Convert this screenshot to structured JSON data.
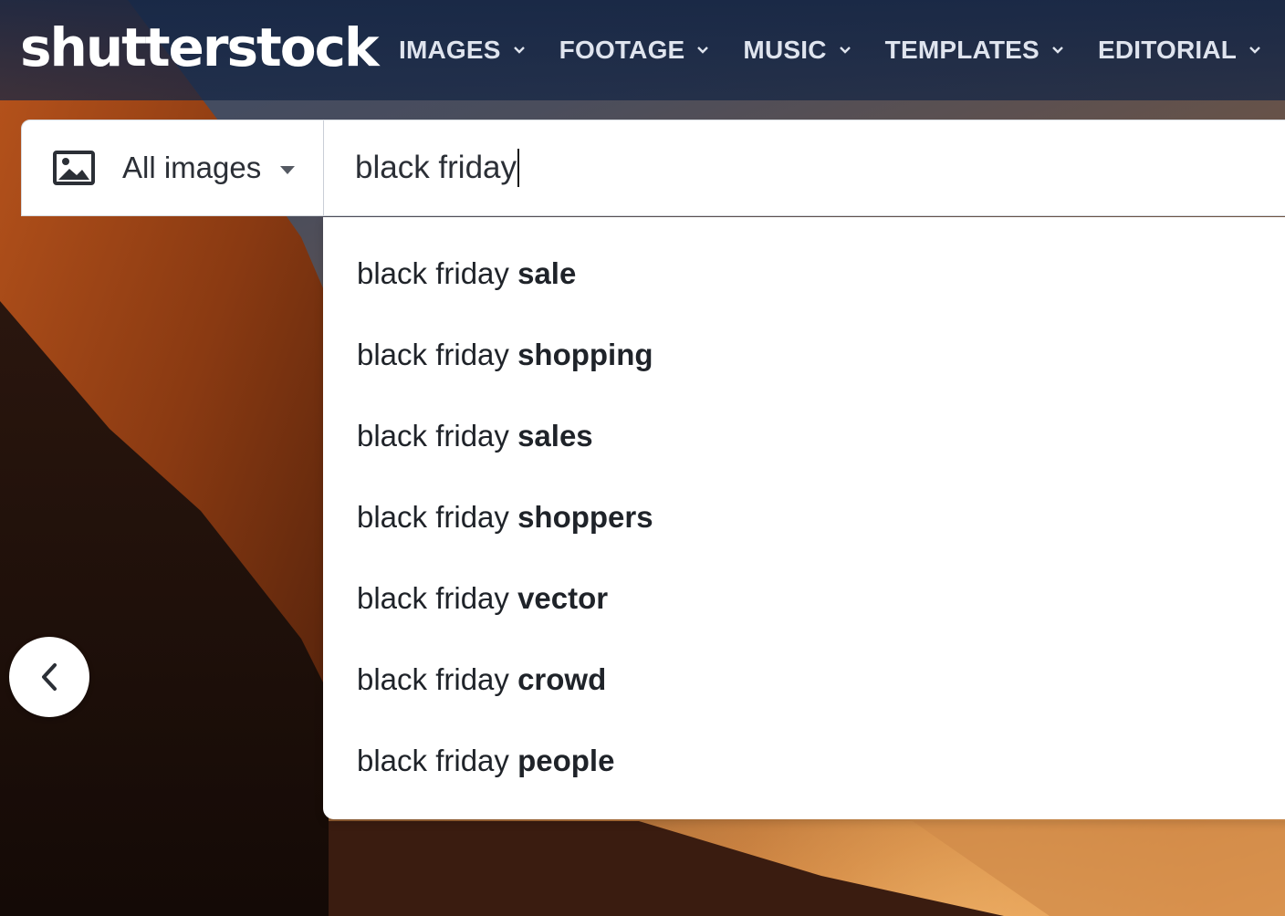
{
  "brand": {
    "logo_text": "shutterstock"
  },
  "nav": {
    "items": [
      {
        "label": "IMAGES"
      },
      {
        "label": "FOOTAGE"
      },
      {
        "label": "MUSIC"
      },
      {
        "label": "TEMPLATES"
      },
      {
        "label": "EDITORIAL"
      }
    ]
  },
  "search": {
    "media_type": "All images",
    "query": "black friday",
    "icon": "image-icon"
  },
  "suggestions": [
    {
      "prefix": "black friday ",
      "completion": "sale"
    },
    {
      "prefix": "black friday ",
      "completion": "shopping"
    },
    {
      "prefix": "black friday ",
      "completion": "sales"
    },
    {
      "prefix": "black friday ",
      "completion": "shoppers"
    },
    {
      "prefix": "black friday ",
      "completion": "vector"
    },
    {
      "prefix": "black friday ",
      "completion": "crowd"
    },
    {
      "prefix": "black friday ",
      "completion": "people"
    }
  ],
  "carousel": {
    "prev_icon": "chevron-left-icon"
  },
  "colors": {
    "nav_bg": "#162644",
    "nav_text": "#dfe4ee",
    "text_primary": "#1f2329"
  }
}
